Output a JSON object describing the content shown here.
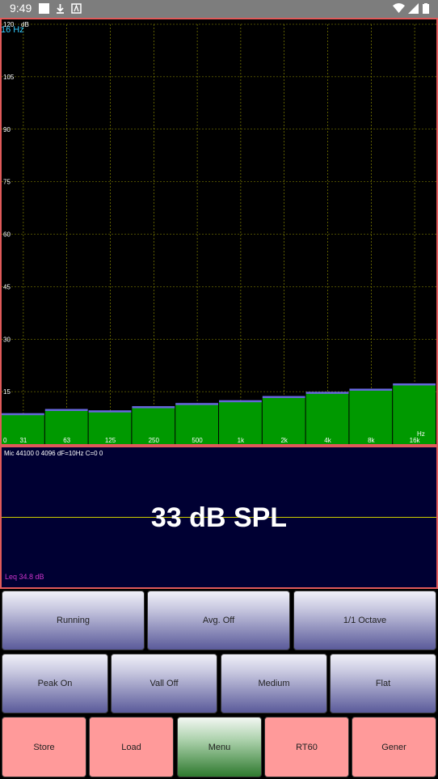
{
  "status_bar": {
    "time": "9:49"
  },
  "chart": {
    "freq_label": "16 Hz",
    "y_unit": "dB",
    "x_unit": "Hz",
    "y_ticks": [
      "120",
      "105",
      "90",
      "75",
      "60",
      "45",
      "30",
      "15",
      "0"
    ],
    "colors": {
      "bar": "#009900",
      "bar_top": "#6666dd",
      "grid": "#999900",
      "frame": "#e05a5a",
      "freq_label": "#33ccff"
    }
  },
  "chart_data": {
    "type": "bar",
    "title": "",
    "xlabel": "Hz",
    "ylabel": "dB",
    "ylim": [
      0,
      120
    ],
    "categories": [
      "31",
      "63",
      "125",
      "250",
      "500",
      "1k",
      "2k",
      "4k",
      "8k",
      "16k"
    ],
    "values": [
      8.5,
      9.7,
      9.3,
      10.5,
      11.4,
      12.2,
      13.4,
      14.6,
      15.5,
      17.0
    ]
  },
  "spl_panel": {
    "info": "Mic 44100 0 4096 dF=10Hz C=0 0",
    "readout": "33 dB SPL",
    "leq": "Leq 34.8 dB"
  },
  "buttons": {
    "row1": [
      "Running",
      "Avg. Off",
      "1/1 Octave"
    ],
    "row2": [
      "Peak On",
      "Vall Off",
      "Medium",
      "Flat"
    ],
    "row3": [
      "Store",
      "Load",
      "Menu",
      "RT60",
      "Gener"
    ]
  }
}
